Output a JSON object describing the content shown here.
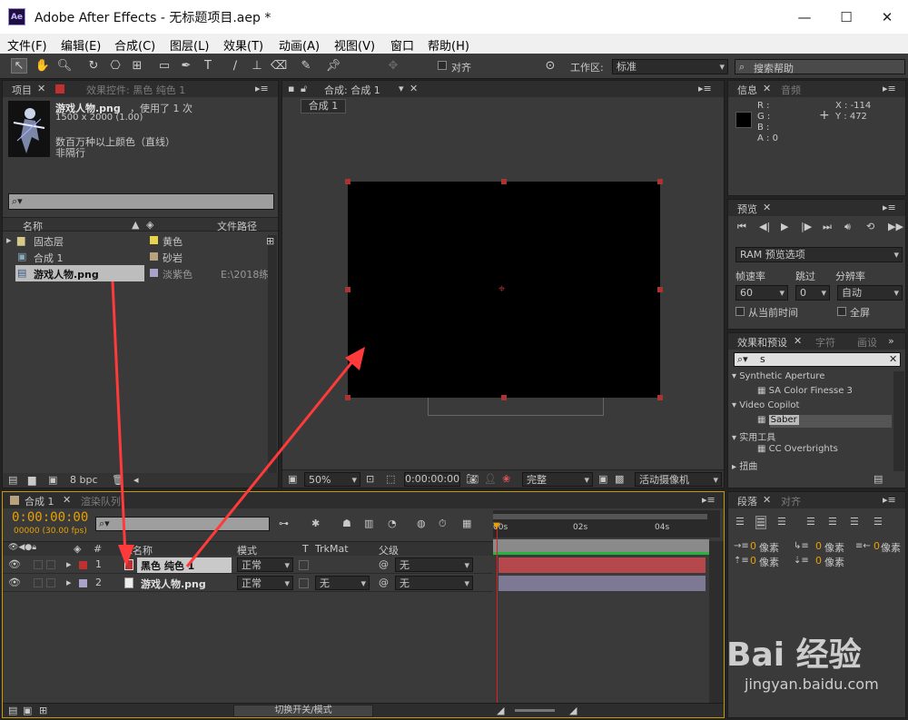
{
  "window": {
    "app_icon": "Ae",
    "title": "Adobe After Effects - 无标题项目.aep *",
    "minimize": "—",
    "maximize": "☐",
    "close": "✕"
  },
  "menu": [
    "文件(F)",
    "编辑(E)",
    "合成(C)",
    "图层(L)",
    "效果(T)",
    "动画(A)",
    "视图(V)",
    "窗口",
    "帮助(H)"
  ],
  "toolbar": {
    "align_label": "对齐",
    "workspace_label": "工作区:",
    "workspace_value": "标准",
    "search_help": "搜索帮助"
  },
  "project_panel": {
    "tab_project": "项目",
    "tab_effects_controls": "效果控件: 黑色 纯色 1",
    "preview_name": "游戏人物.png",
    "preview_usage": "，使用了 1 次",
    "preview_dims": "1500 x 2000 (1.00)",
    "preview_colors": "数百万种以上颜色（直线）",
    "preview_interlace": "非隔行",
    "search_placeholder": "",
    "col_name": "名称",
    "col_path": "文件路径",
    "items": [
      {
        "name": "固态层",
        "label": "黄色",
        "color": "#e8d44a",
        "path": ""
      },
      {
        "name": "合成 1",
        "label": "砂岩",
        "color": "#b9a27e",
        "path": ""
      },
      {
        "name": "游戏人物.png",
        "label": "淡紫色",
        "color": "#a9a3cc",
        "path": "E:\\2018练"
      }
    ],
    "bpc": "8 bpc"
  },
  "comp_panel": {
    "tab_label": "合成: 合成 1",
    "sub_tab": "合成 1",
    "zoom": "50%",
    "timecode": "0:00:00:00",
    "resolution": "完整",
    "camera": "活动摄像机",
    "solid_color": "#000000"
  },
  "info_panel": {
    "tab_info": "信息",
    "tab_audio": "音频",
    "r": "R :",
    "g": "G :",
    "b": "B :",
    "a": "A : 0",
    "x": "X : -114",
    "y": "Y : 472"
  },
  "preview_panel": {
    "tab": "预览",
    "ram_options": "RAM 预览选项",
    "frame_rate_label": "帧速率",
    "skip_label": "跳过",
    "resolution_label": "分辨率",
    "frame_rate": "60",
    "skip": "0",
    "resolution": "自动",
    "from_current": "从当前时间",
    "fullscreen": "全屏"
  },
  "effects_panel": {
    "tab": "效果和预设",
    "tab_char": "字符",
    "tab_para": "画设",
    "search_value": "s",
    "groups": [
      {
        "name": "Synthetic Aperture",
        "items": [
          "SA Color Finesse 3"
        ]
      },
      {
        "name": "Video Copilot",
        "items": [
          "Saber"
        ]
      },
      {
        "name": "实用工具",
        "items": [
          "CC Overbrights"
        ]
      },
      {
        "name": "扭曲",
        "items": []
      }
    ]
  },
  "paragraph_panel": {
    "tab": "段落",
    "tab_align": "对齐",
    "unit": "像素",
    "zero": "0"
  },
  "timeline": {
    "tab_comp": "合成 1",
    "tab_render": "渲染队列",
    "timecode": "0:00:00:00",
    "fps": "00000 (30.00 fps)",
    "col_num": "#",
    "col_source": "源名称",
    "col_mode": "模式",
    "col_t": "T",
    "col_trkmat": "TrkMat",
    "col_parent": "父级",
    "ruler": [
      "00s",
      "02s",
      "04s"
    ],
    "layers": [
      {
        "num": "1",
        "name": "黑色 纯色 1",
        "mode": "正常",
        "trkmat": "",
        "parent": "无",
        "color": "#c03030",
        "bar": "#b5484c"
      },
      {
        "num": "2",
        "name": "游戏人物.png",
        "mode": "正常",
        "trkmat": "无",
        "parent": "无",
        "color": "#a9a3cc",
        "bar": "#7d7894"
      }
    ],
    "toggle_modes": "切换开关/模式"
  },
  "watermark": {
    "brand": "Bai 经验",
    "url": "jingyan.baidu.com"
  }
}
